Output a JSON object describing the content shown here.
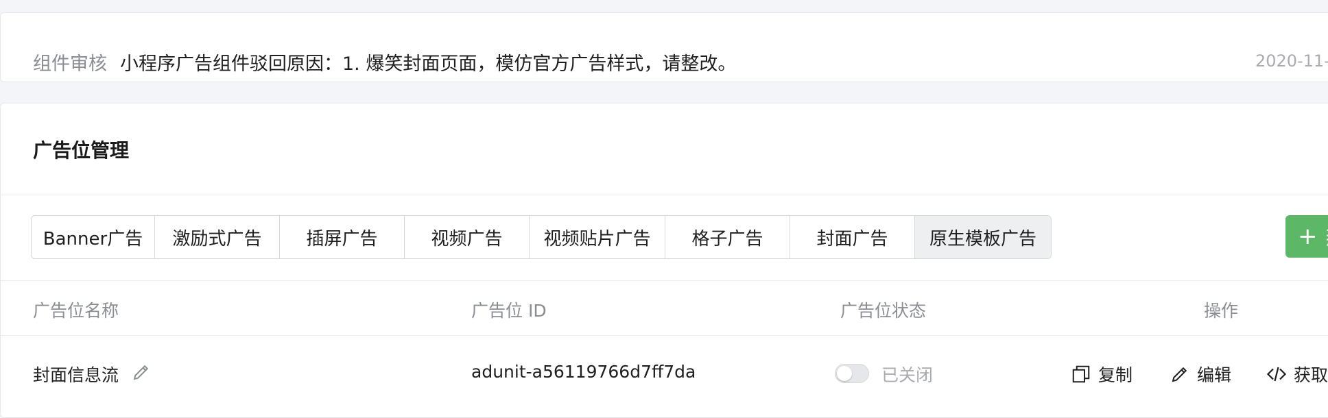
{
  "notice": {
    "tag": "组件审核",
    "message": "小程序广告组件驳回原因：1. 爆笑封面页面，模仿官方广告样式，请整改。",
    "date": "2020-11-"
  },
  "panel": {
    "title": "广告位管理",
    "tabs": [
      {
        "label": "Banner广告"
      },
      {
        "label": "激励式广告"
      },
      {
        "label": "插屏广告"
      },
      {
        "label": "视频广告"
      },
      {
        "label": "视频贴片广告"
      },
      {
        "label": "格子广告"
      },
      {
        "label": "封面广告"
      },
      {
        "label": "原生模板广告",
        "active": true
      }
    ],
    "new_button": {
      "icon": "plus-icon",
      "label": "新"
    },
    "table": {
      "headers": {
        "name": "广告位名称",
        "id": "广告位 ID",
        "status": "广告位状态",
        "actions": "操作"
      },
      "rows": [
        {
          "name": "封面信息流",
          "id": "adunit-a56119766d7ff7da",
          "status": "已关闭",
          "enabled": false,
          "actions": {
            "copy": "复制",
            "edit": "编辑",
            "get_code": "获取"
          }
        }
      ]
    }
  },
  "colors": {
    "accent_green": "#5cb867",
    "muted_text": "#8a8d93",
    "page_bg": "#f4f5f9"
  }
}
